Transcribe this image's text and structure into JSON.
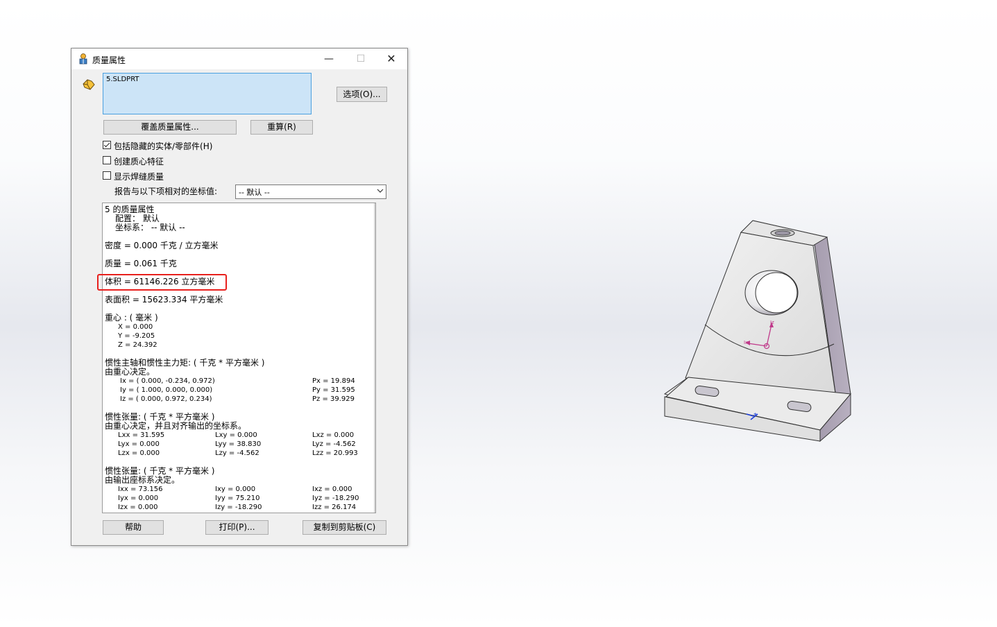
{
  "dialog": {
    "title": "质量属性",
    "minimize_glyph": "—",
    "maximize_glyph": "☐",
    "close_glyph": "✕",
    "selected_file": "5.SLDPRT",
    "options_button": "选项(O)...",
    "override_button": "覆盖质量属性...",
    "recalc_button": "重算(R)",
    "include_hidden_label": "包括隐藏的实体/零部件(H)",
    "include_hidden_checked": true,
    "create_com_label": "创建质心特征",
    "create_com_checked": false,
    "show_weld_label": "显示焊缝质量",
    "show_weld_checked": false,
    "coord_label": "报告与以下项相对的坐标值:",
    "coord_value": "-- 默认 --",
    "help_button": "帮助",
    "print_button": "打印(P)...",
    "copy_button": "复制到剪贴板(C)"
  },
  "results": {
    "heading": "5 的质量属性",
    "config": "配置：  默认",
    "coordsys": "坐标系：  -- 默认 --",
    "density": "密度 = 0.000 千克 / 立方毫米",
    "mass": "质量 = 0.061 千克",
    "volume": "体积 = 61146.226 立方毫米",
    "surface_area": "表面积 = 15623.334  平方毫米",
    "com_heading": "重心 : ( 毫米 )",
    "com_x": "X = 0.000",
    "com_y": "Y = -9.205",
    "com_z": "Z = 24.392",
    "principal_heading": "惯性主轴和惯性主力矩: ( 千克 *  平方毫米 )",
    "principal_sub": "由重心决定。",
    "ix": "Ix = ( 0.000, -0.234,  0.972)",
    "iy": "Iy = ( 1.000,  0.000,  0.000)",
    "iz": "Iz = ( 0.000,  0.972,  0.234)",
    "px": "Px = 19.894",
    "py": "Py = 31.595",
    "pz": "Pz = 39.929",
    "tensor_com_heading": "惯性张量: ( 千克 *  平方毫米 )",
    "tensor_com_sub": "由重心决定，并且对齐输出的坐标系。",
    "lxx": "Lxx = 31.595",
    "lxy": "Lxy = 0.000",
    "lxz": "Lxz = 0.000",
    "lyx": "Lyx = 0.000",
    "lyy": "Lyy = 38.830",
    "lyz": "Lyz = -4.562",
    "lzx": "Lzx = 0.000",
    "lzy": "Lzy = -4.562",
    "lzz": "Lzz = 20.993",
    "tensor_out_heading": "惯性张量: ( 千克 *  平方毫米 )",
    "tensor_out_sub": "由输出座标系决定。",
    "ixx": "Ixx = 73.156",
    "ixy": "Ixy = 0.000",
    "ixz": "Ixz = 0.000",
    "iyx": "Iyx = 0.000",
    "iyy": "Iyy = 75.210",
    "iyz": "Iyz = -18.290",
    "izx": "Izx = 0.000",
    "izy": "Izy = -18.290",
    "izz": "Izz = 26.174"
  },
  "viewport": {
    "triad_x": "Ix",
    "triad_z": "Iz"
  },
  "colors": {
    "highlight": "#e8201d",
    "list_selection": "#cce4f7",
    "list_border": "#4aa0df",
    "triad": "#c0398a",
    "origin_marker": "#1a3cdc"
  },
  "icons": [
    "mass-properties-icon",
    "part-icon",
    "chevron-down-icon",
    "center-of-mass-icon",
    "origin-icon"
  ]
}
